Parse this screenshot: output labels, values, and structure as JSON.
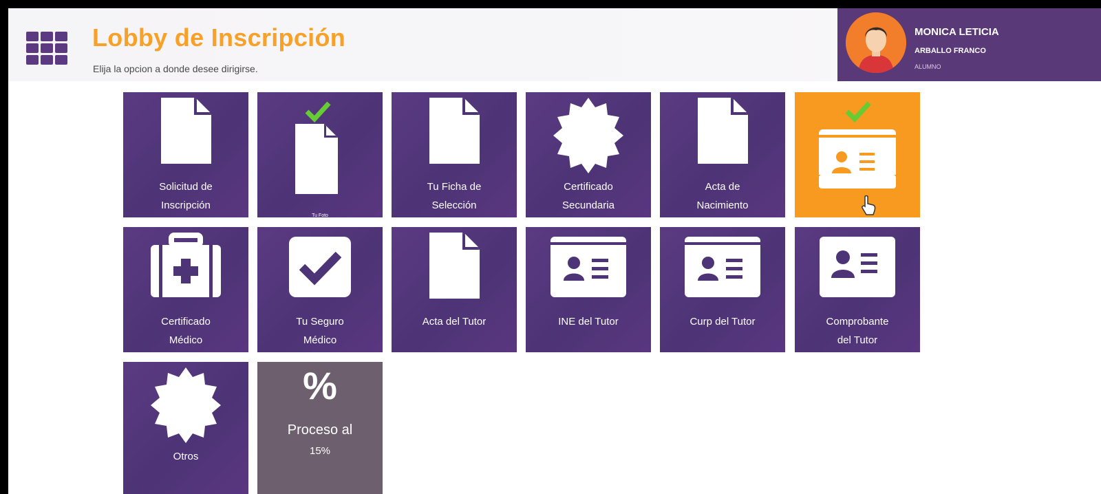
{
  "header": {
    "title": "Lobby de Inscripción",
    "subtitle": "Elija la opcion a donde desee dirigirse."
  },
  "user": {
    "first_names": "MONICA LETICIA",
    "last_names": "ARBALLO FRANCO",
    "role": "ALUMNO"
  },
  "colors": {
    "tile_purple": "#5b3a82",
    "tile_active_orange": "#f79a1f",
    "title_orange": "#f7a128",
    "check_green": "#66cc33",
    "progress_tile_gray": "#6d5f6e"
  },
  "tiles": [
    {
      "label_line1": "Solicitud de",
      "label_line2": "Inscripción",
      "icon": "document-icon",
      "completed": false
    },
    {
      "label": "Tu Foto",
      "icon": "document-icon",
      "completed": true
    },
    {
      "label_line1": "Tu Ficha de",
      "label_line2": "Selección",
      "icon": "document-icon",
      "completed": false
    },
    {
      "label_line1": "Certificado",
      "label_line2": "Secundaria",
      "icon": "certificate-seal-icon",
      "completed": false
    },
    {
      "label_line1": "Acta de",
      "label_line2": "Nacimiento",
      "icon": "document-icon",
      "completed": false
    },
    {
      "label": "",
      "icon": "id-card-icon",
      "completed": true,
      "active": true
    },
    {
      "label_line1": "Certificado",
      "label_line2": "Médico",
      "icon": "medical-kit-icon",
      "completed": false
    },
    {
      "label_line1": "Tu Seguro",
      "label_line2": "Médico",
      "icon": "checkbox-icon",
      "completed": false
    },
    {
      "label": "Acta del Tutor",
      "icon": "document-icon",
      "completed": false
    },
    {
      "label": "INE del Tutor",
      "icon": "id-card-icon",
      "completed": false
    },
    {
      "label": "Curp del Tutor",
      "icon": "id-card-icon",
      "completed": false
    },
    {
      "label_line1": "Comprobante",
      "label_line2": "del Tutor",
      "icon": "id-card-icon",
      "completed": false
    },
    {
      "label": "Otros",
      "icon": "certificate-seal-icon",
      "completed": false
    }
  ],
  "progress": {
    "symbol": "%",
    "label_line1": "Proceso al",
    "label_line2": "15%",
    "value_percent": 15
  }
}
